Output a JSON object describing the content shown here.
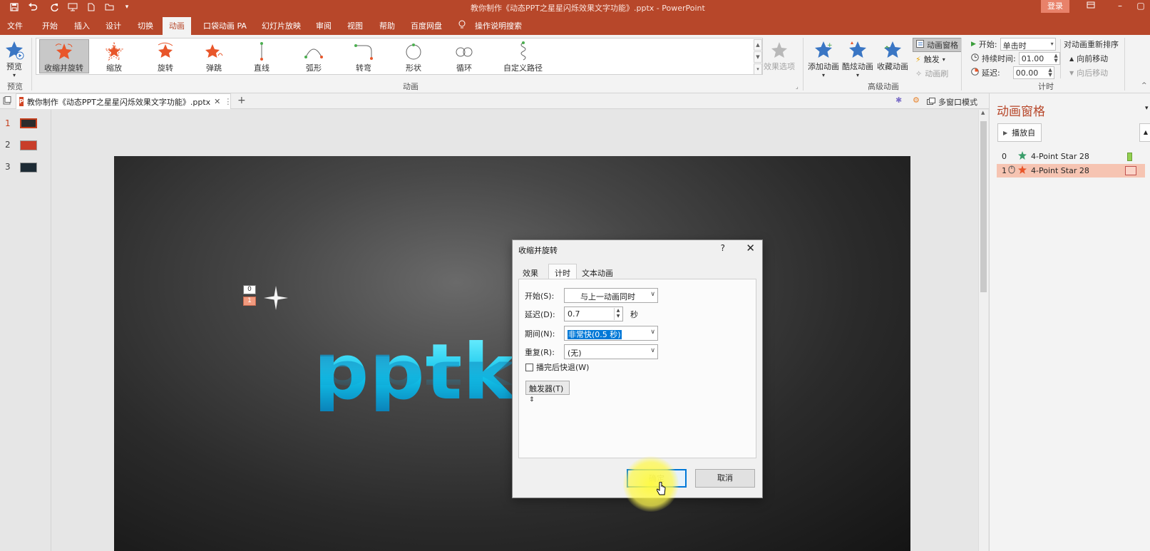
{
  "window": {
    "title": "教你制作《动态PPT之星星闪烁效果文字功能》.pptx  -  PowerPoint",
    "login_label": "登录"
  },
  "menu": {
    "tabs": [
      "文件",
      "开始",
      "插入",
      "设计",
      "切换",
      "动画",
      "口袋动画 PA",
      "幻灯片放映",
      "审阅",
      "视图",
      "帮助",
      "百度网盘"
    ],
    "active_tab": "动画",
    "search_label": "操作说明搜索"
  },
  "ribbon": {
    "preview": {
      "label": "预览",
      "group": "预览"
    },
    "gallery_items": [
      "收缩并旋转",
      "缩放",
      "旋转",
      "弹跳",
      "直线",
      "弧形",
      "转弯",
      "形状",
      "循环",
      "自定义路径"
    ],
    "gallery_selected": "收缩并旋转",
    "effect_options": "效果选项",
    "animation_group": "动画",
    "advanced": {
      "add_animation": "添加动画",
      "cool_animation": "酷炫动画",
      "favorite_animation": "收藏动画",
      "animation_pane": "动画窗格",
      "trigger": "触发",
      "animation_painter": "动画刷",
      "group": "高级动画"
    },
    "timing": {
      "start_label": "开始:",
      "start_value": "单击时",
      "duration_label": "持续时间:",
      "duration_value": "01.00",
      "delay_label": "延迟:",
      "delay_value": "00.00",
      "reorder_title": "对动画重新排序",
      "move_earlier": "向前移动",
      "move_later": "向后移动",
      "group": "计时"
    }
  },
  "doc_tab": {
    "label": "教你制作《动态PPT之星星闪烁效果文字功能》.pptx",
    "badge": "P",
    "multi_window": "多窗口模式"
  },
  "thumbnails": [
    "1",
    "2",
    "3"
  ],
  "slide": {
    "text": "pptke",
    "tag0": "0",
    "tag1": "1"
  },
  "animation_pane": {
    "title": "动画窗格",
    "play_label": "播放自",
    "items": [
      {
        "num": "0",
        "label": "4-Point Star 28",
        "color": "#92d050"
      },
      {
        "num": "1",
        "label": "4-Point Star 28",
        "color": "#e8562a"
      }
    ]
  },
  "dialog": {
    "title": "收缩并旋转",
    "help": "?",
    "tabs": [
      "效果",
      "计时",
      "文本动画"
    ],
    "active_tab": "计时",
    "start_label": "开始(S):",
    "start_value": "与上一动画同时",
    "delay_label": "延迟(D):",
    "delay_value": "0.7",
    "delay_unit": "秒",
    "duration_label": "期间(N):",
    "duration_value": "非常快(0.5 秒)",
    "repeat_label": "重复(R):",
    "repeat_value": "(无)",
    "rewind_label": "播完后快退(W)",
    "rewind_checked": false,
    "trigger_label": "触发器(T)",
    "ok_label": "确定",
    "cancel_label": "取消"
  },
  "colors": {
    "accent": "#b7472a",
    "selection": "#0078d7",
    "slide_text": "#11c3ea"
  }
}
